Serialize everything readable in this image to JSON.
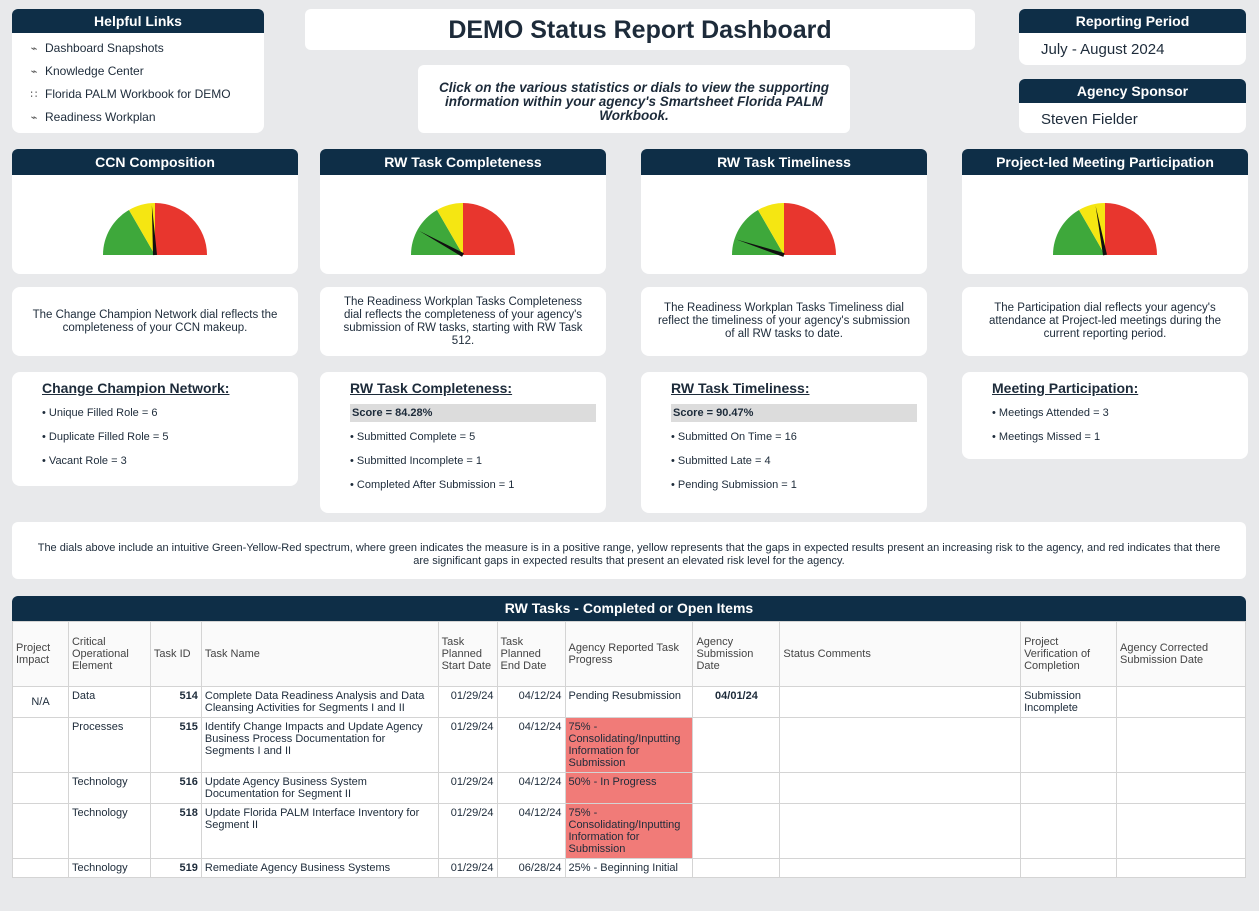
{
  "links": {
    "title": "Helpful Links",
    "items": [
      {
        "label": "Dashboard Snapshots",
        "icon": "link-icon"
      },
      {
        "label": "Knowledge Center",
        "icon": "link-icon"
      },
      {
        "label": "Florida PALM Workbook for DEMO",
        "icon": "workspace-icon"
      },
      {
        "label": "Readiness Workplan",
        "icon": "link-icon"
      }
    ]
  },
  "title": "DEMO Status Report Dashboard",
  "instructions": "Click on the various statistics or dials to view the supporting information within your agency's Smartsheet Florida PALM Workbook.",
  "reporting_period": {
    "label": "Reporting Period",
    "value": "July - August 2024"
  },
  "sponsor": {
    "label": "Agency Sponsor",
    "value": "Steven Fielder"
  },
  "dials": [
    {
      "title": "CCN Composition",
      "needle": 0.48,
      "desc": "The Change Champion Network dial reflects the completeness of your CCN makeup.",
      "stat_title": "Change Champion Network:",
      "score": "",
      "items": [
        "Unique Filled Role = 6",
        "Duplicate Filled Role = 5",
        "Vacant Role = 3"
      ]
    },
    {
      "title": "RW Task Completeness",
      "needle": 0.16,
      "desc": "The Readiness Workplan Tasks Completeness dial reflects the completeness of your agency's submission of RW tasks, starting with RW Task 512.",
      "stat_title": "RW Task Completeness:",
      "score": "Score = 84.28%",
      "items": [
        "Submitted Complete = 5",
        "Submitted Incomplete = 1",
        "Completed After Submission = 1"
      ]
    },
    {
      "title": "RW Task Timeliness",
      "needle": 0.1,
      "desc": "The Readiness Workplan Tasks Timeliness dial reflect the timeliness of your agency's submission of all RW tasks to date.",
      "stat_title": "RW Task Timeliness:",
      "score": "Score = 90.47%",
      "items": [
        "Submitted On Time = 16",
        "Submitted Late = 4",
        "Pending Submission = 1"
      ]
    },
    {
      "title": "Project-led Meeting Participation",
      "needle": 0.44,
      "desc": "The Participation dial reflects your agency's attendance at Project-led meetings during the current reporting period.",
      "stat_title": "Meeting Participation:",
      "score": "",
      "items": [
        "Meetings Attended = 3",
        "Meetings Missed = 1"
      ]
    }
  ],
  "note": "The dials above include an intuitive Green-Yellow-Red spectrum, where green indicates the measure is in a positive range, yellow represents that the gaps in expected results present an increasing risk to the agency, and red indicates that there are significant gaps in expected results that present an elevated risk level for the agency.",
  "table": {
    "title": "RW Tasks - Completed or Open Items",
    "columns": [
      "Project Impact",
      "Critical Operational Element",
      "Task ID",
      "Task Name",
      "Task Planned Start Date",
      "Task Planned End Date",
      "Agency Reported Task Progress",
      "Agency Submission Date",
      "Status Comments",
      "Project Verification of Completion",
      "Agency Corrected Submission Date"
    ],
    "rows": [
      {
        "impact": "N/A",
        "element": "Data",
        "id": "514",
        "name": "Complete Data Readiness Analysis and Data Cleansing Activities for Segments I and II",
        "start": "01/29/24",
        "end": "04/12/24",
        "progress": "Pending Resubmission",
        "progress_red": false,
        "submitted": "04/01/24",
        "comments": "",
        "verification": "Submission Incomplete",
        "corrected": ""
      },
      {
        "impact": "",
        "element": "Processes",
        "id": "515",
        "name": "Identify Change Impacts and Update Agency Business Process Documentation for Segments I and II",
        "start": "01/29/24",
        "end": "04/12/24",
        "progress": "75% - Consolidating/Inputting Information for Submission",
        "progress_red": true,
        "submitted": "",
        "comments": "",
        "verification": "",
        "corrected": ""
      },
      {
        "impact": "",
        "element": "Technology",
        "id": "516",
        "name": "Update Agency Business System Documentation for Segment II",
        "start": "01/29/24",
        "end": "04/12/24",
        "progress": "50% - In Progress",
        "progress_red": true,
        "submitted": "",
        "comments": "",
        "verification": "",
        "corrected": ""
      },
      {
        "impact": "",
        "element": "Technology",
        "id": "518",
        "name": "Update Florida PALM Interface Inventory for Segment II",
        "start": "01/29/24",
        "end": "04/12/24",
        "progress": "75% - Consolidating/Inputting Information for Submission",
        "progress_red": true,
        "submitted": "",
        "comments": "",
        "verification": "",
        "corrected": ""
      },
      {
        "impact": "",
        "element": "Technology",
        "id": "519",
        "name": "Remediate Agency Business Systems",
        "start": "01/29/24",
        "end": "06/28/24",
        "progress": "25% - Beginning Initial",
        "progress_red": false,
        "submitted": "",
        "comments": "",
        "verification": "",
        "corrected": ""
      }
    ]
  }
}
